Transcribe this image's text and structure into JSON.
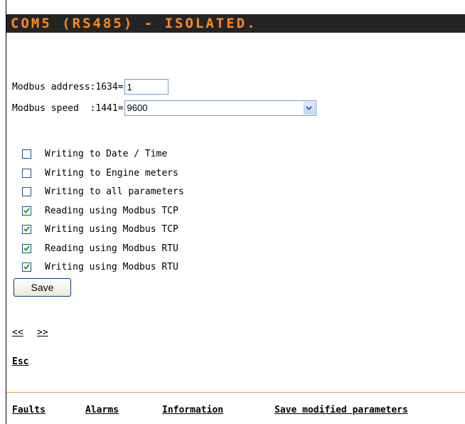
{
  "header": {
    "title": "COM5 (RS485) - ISOLATED."
  },
  "modbus_address": {
    "label": "Modbus address:1634=",
    "value": "1"
  },
  "modbus_speed": {
    "label": "Modbus speed  :1441=",
    "value": "9600"
  },
  "options": [
    {
      "label": "Writing to Date / Time",
      "checked": false
    },
    {
      "label": "Writing to Engine meters",
      "checked": false
    },
    {
      "label": "Writing to all parameters",
      "checked": false
    },
    {
      "label": "Reading using Modbus TCP",
      "checked": true
    },
    {
      "label": "Writing using Modbus TCP",
      "checked": true
    },
    {
      "label": "Reading using Modbus RTU",
      "checked": true
    },
    {
      "label": "Writing using Modbus RTU",
      "checked": true
    }
  ],
  "save_label": "Save",
  "nav": {
    "prev": "<<",
    "next": ">>",
    "esc": "Esc"
  },
  "footer": {
    "faults": "Faults",
    "alarms": "Alarms",
    "information": "Information",
    "save_modified": "Save modified parameters"
  },
  "colors": {
    "title_bg": "#242424",
    "title_fg": "#ff8a1f",
    "divider": "#e0a060"
  }
}
